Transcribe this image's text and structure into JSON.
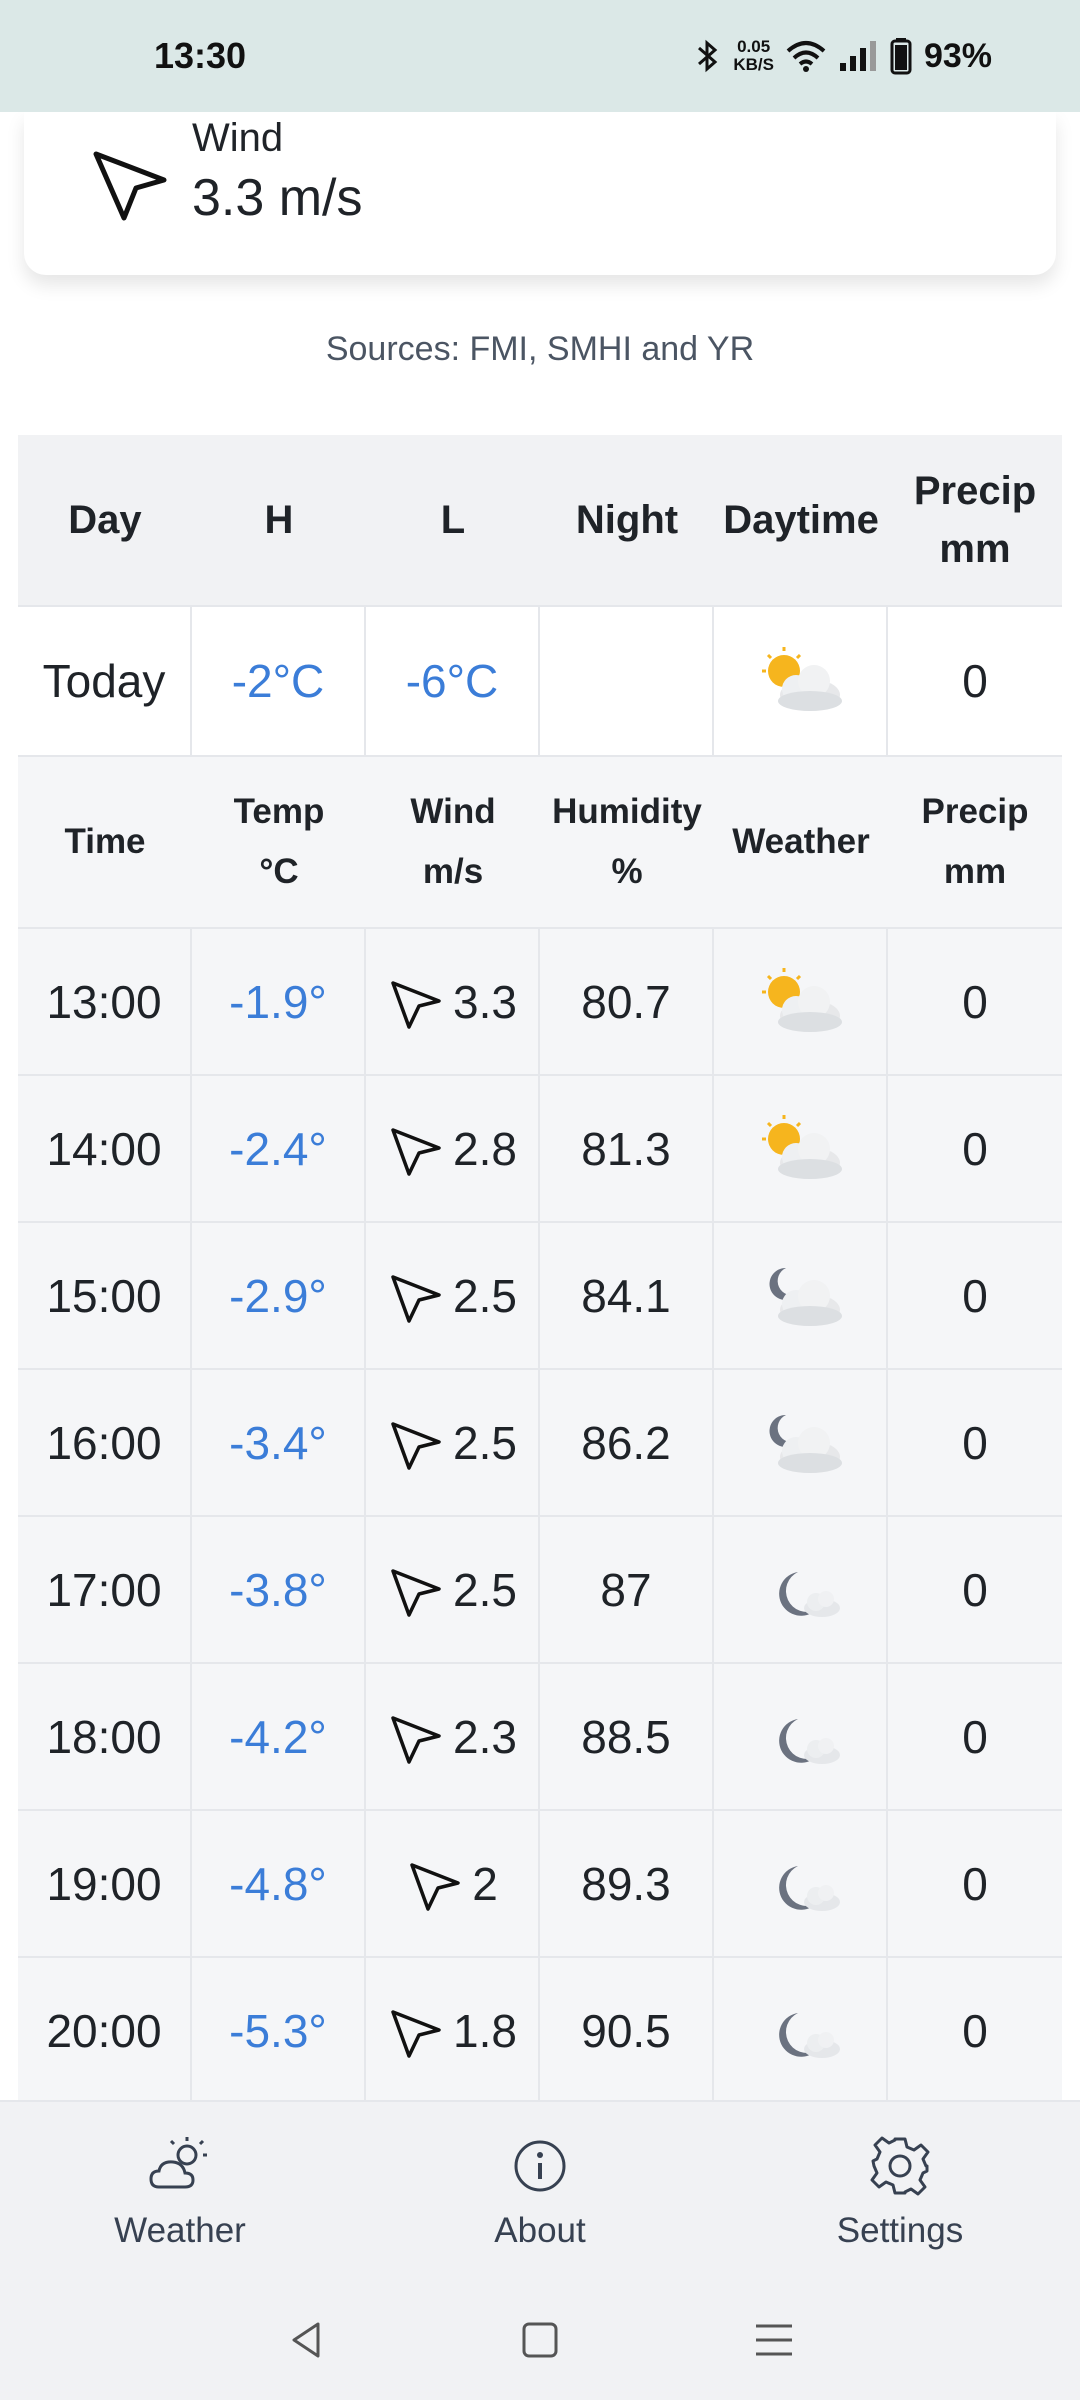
{
  "status_bar": {
    "time": "13:30",
    "net_speed_value": "0.05",
    "net_speed_unit": "KB/S",
    "battery": "93%",
    "icons": [
      "bluetooth-icon",
      "wifi-icon",
      "signal-icon",
      "battery-icon"
    ]
  },
  "wind_card": {
    "label": "Wind",
    "value": "3.3 m/s"
  },
  "sources": "Sources: FMI, SMHI and YR",
  "day_table": {
    "headers": {
      "day": "Day",
      "high": "H",
      "low": "L",
      "night": "Night",
      "daytime": "Daytime",
      "precip_line1": "Precip",
      "precip_line2": "mm"
    },
    "today": {
      "day": "Today",
      "high": "-2°C",
      "low": "-6°C",
      "night": "",
      "daytime_icon": "partly-sunny-icon",
      "precip": "0"
    }
  },
  "hour_table": {
    "headers": {
      "time": "Time",
      "temp_line1": "Temp",
      "temp_line2": "°C",
      "wind_line1": "Wind",
      "wind_line2": "m/s",
      "humidity_line1": "Humidity",
      "humidity_line2": "%",
      "weather": "Weather",
      "precip_line1": "Precip",
      "precip_line2": "mm"
    },
    "rows": [
      {
        "time": "13:00",
        "temp": "-1.9°",
        "wind": "3.3",
        "humidity": "80.7",
        "weather_icon": "partly-sunny-icon",
        "precip": "0"
      },
      {
        "time": "14:00",
        "temp": "-2.4°",
        "wind": "2.8",
        "humidity": "81.3",
        "weather_icon": "partly-sunny-icon",
        "precip": "0"
      },
      {
        "time": "15:00",
        "temp": "-2.9°",
        "wind": "2.5",
        "humidity": "84.1",
        "weather_icon": "partly-cloudy-night-icon",
        "precip": "0"
      },
      {
        "time": "16:00",
        "temp": "-3.4°",
        "wind": "2.5",
        "humidity": "86.2",
        "weather_icon": "partly-cloudy-night-icon",
        "precip": "0"
      },
      {
        "time": "17:00",
        "temp": "-3.8°",
        "wind": "2.5",
        "humidity": "87",
        "weather_icon": "moon-cloud-icon",
        "precip": "0"
      },
      {
        "time": "18:00",
        "temp": "-4.2°",
        "wind": "2.3",
        "humidity": "88.5",
        "weather_icon": "moon-cloud-icon",
        "precip": "0"
      },
      {
        "time": "19:00",
        "temp": "-4.8°",
        "wind": "2",
        "humidity": "89.3",
        "weather_icon": "moon-cloud-icon",
        "precip": "0"
      },
      {
        "time": "20:00",
        "temp": "-5.3°",
        "wind": "1.8",
        "humidity": "90.5",
        "weather_icon": "moon-cloud-icon",
        "precip": "0"
      }
    ]
  },
  "bottom_nav": {
    "items": [
      {
        "label": "Weather",
        "icon": "weather-icon"
      },
      {
        "label": "About",
        "icon": "info-icon"
      },
      {
        "label": "Settings",
        "icon": "gear-icon"
      }
    ]
  },
  "system_nav": {
    "icons": [
      "back-icon",
      "home-icon",
      "menu-icon"
    ]
  },
  "colors": {
    "status_bar_bg": "#dbe8e7",
    "temperature_blue": "#3b7dd8",
    "table_bg": "#f5f6f8",
    "nav_bg": "#f1f2f4"
  }
}
